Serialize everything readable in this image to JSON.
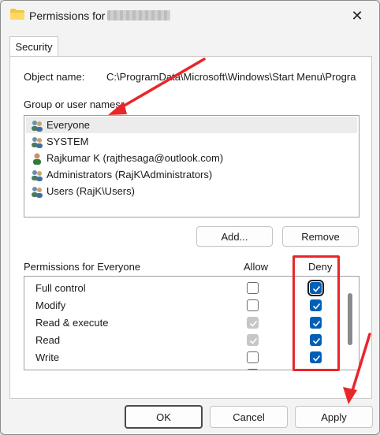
{
  "window": {
    "title": "Permissions for",
    "close_glyph": "✕"
  },
  "tabs": [
    {
      "label": "Security"
    }
  ],
  "object": {
    "label": "Object name:",
    "value": "C:\\ProgramData\\Microsoft\\Windows\\Start Menu\\Progra"
  },
  "groups": {
    "label": "Group or user names:",
    "items": [
      {
        "label": "Everyone",
        "icon": "user-group-icon",
        "selected": true
      },
      {
        "label": "SYSTEM",
        "icon": "user-group-icon",
        "selected": false
      },
      {
        "label": "Rajkumar K (rajthesaga@outlook.com)",
        "icon": "user-icon",
        "selected": false
      },
      {
        "label": "Administrators (RajK\\Administrators)",
        "icon": "user-group-icon",
        "selected": false
      },
      {
        "label": "Users (RajK\\Users)",
        "icon": "user-group-icon",
        "selected": false
      }
    ]
  },
  "buttons": {
    "add": "Add...",
    "remove": "Remove",
    "ok": "OK",
    "cancel": "Cancel",
    "apply": "Apply"
  },
  "permissions": {
    "label": "Permissions for Everyone",
    "allow_header": "Allow",
    "deny_header": "Deny",
    "rows": [
      {
        "name": "Full control",
        "allow": "unchecked",
        "deny": "checked"
      },
      {
        "name": "Modify",
        "allow": "unchecked",
        "deny": "checked"
      },
      {
        "name": "Read & execute",
        "allow": "inherited",
        "deny": "checked"
      },
      {
        "name": "Read",
        "allow": "inherited",
        "deny": "checked"
      },
      {
        "name": "Write",
        "allow": "unchecked",
        "deny": "checked"
      }
    ]
  },
  "colors": {
    "accent": "#005fb8",
    "annotation": "#e8262a"
  }
}
